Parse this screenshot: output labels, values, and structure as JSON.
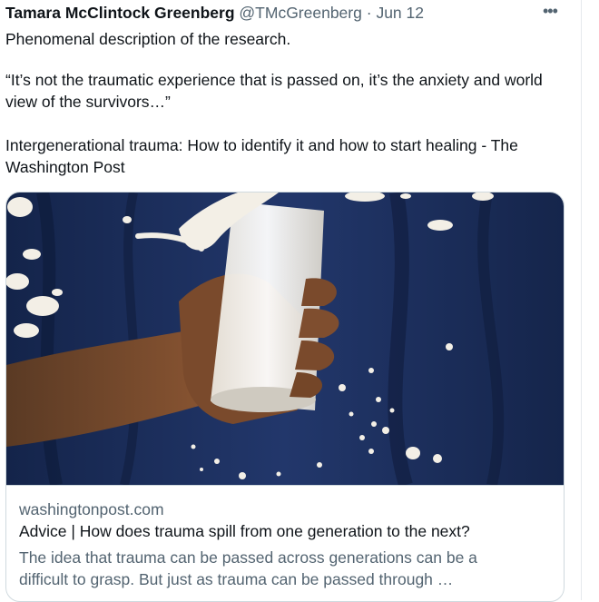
{
  "tweet": {
    "author_name": "Tamara McClintock Greenberg",
    "handle": "@TMcGreenberg",
    "separator": "·",
    "date": "Jun 12",
    "more_label": "•••",
    "text_lines": [
      "Phenomenal description of the research.",
      "“It’s not the traumatic experience that is passed on, it’s the anxiety and world view of the survivors…”",
      "Intergenerational trauma: How to identify it and how to start healing - The Washington Post"
    ]
  },
  "link_card": {
    "domain": "washingtonpost.com",
    "title": "Advice | How does trauma spill from one generation to the next?",
    "description": "The idea that trauma can be passed across generations can be a difficult to grasp. But just as trauma can be passed through …",
    "image_subject": "hand holding a glass of milk with milk splashing",
    "colors": {
      "background": "#1d2f5b",
      "skin": "#7a4a2c",
      "milk": "#f3efe6"
    }
  }
}
